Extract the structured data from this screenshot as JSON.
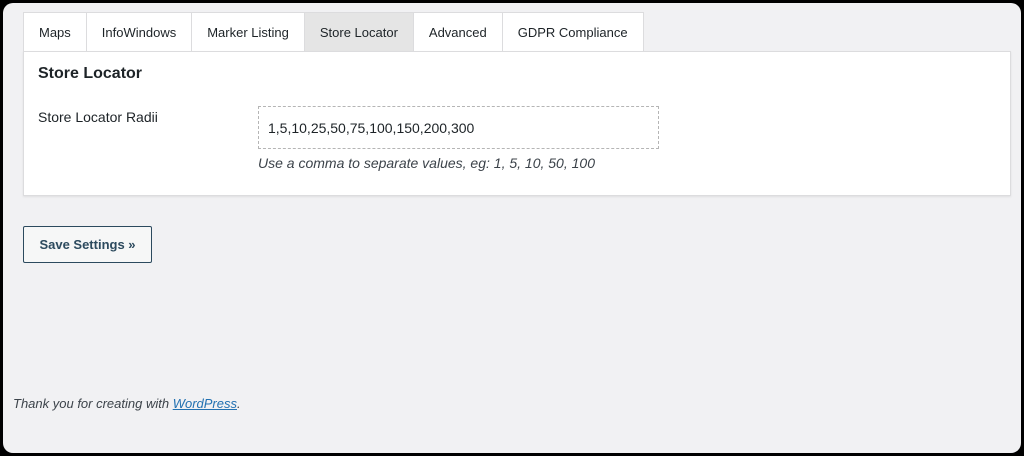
{
  "tabs": [
    {
      "label": "Maps"
    },
    {
      "label": "InfoWindows"
    },
    {
      "label": "Marker Listing"
    },
    {
      "label": "Store Locator",
      "active": true
    },
    {
      "label": "Advanced"
    },
    {
      "label": "GDPR Compliance"
    }
  ],
  "panel": {
    "title": "Store Locator",
    "field": {
      "label": "Store Locator Radii",
      "value": "1,5,10,25,50,75,100,150,200,300",
      "help": "Use a comma to separate values, eg: 1, 5, 10, 50, 100"
    }
  },
  "save_button": {
    "label": "Save Settings »"
  },
  "footer": {
    "prefix": "Thank you for creating with ",
    "link_text": "WordPress",
    "suffix": "."
  },
  "colors": {
    "background": "#f1f1f3",
    "active_tab": "#e5e5e5",
    "link": "#2271b1",
    "button_border": "#2c4a5e"
  }
}
